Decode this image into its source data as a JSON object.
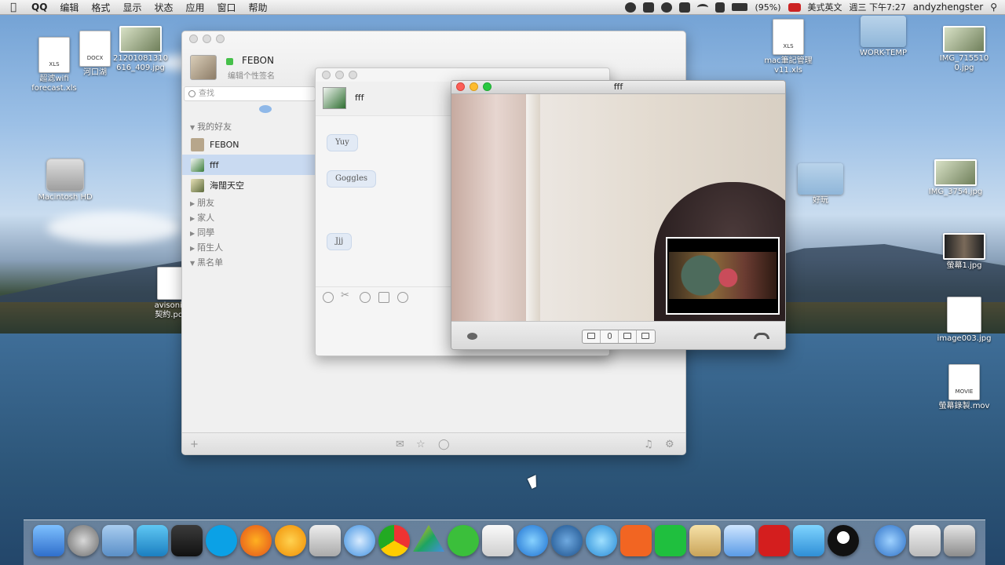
{
  "menubar": {
    "apple": "",
    "app": "QQ",
    "menus": [
      "编辑",
      "格式",
      "显示",
      "状态",
      "应用",
      "窗口",
      "帮助"
    ],
    "battery": "(95%)",
    "input_source": "美式英文",
    "clock": "週三 下午7:27",
    "user": "andyzhengster"
  },
  "desktop_icons": {
    "xls_label": "超滤wifi\nforecast.xls",
    "xls_tag": "XLS",
    "docx_label": "河口湖",
    "docx_tag": "DOCX",
    "img1_label": "21201081310\n616_409.jpg",
    "hd_label": "Macintosh HD",
    "pdf_label": "avisonic\n契約.pdf",
    "mac_xls_label": "mac筆記管理\nv11.xls",
    "mac_xls_tag": "XLS",
    "work_temp_label": "WORK-TEMP",
    "img_right1_label": "IMG_715510\n0.jpg",
    "folder2_label": "好玩",
    "img3754_label": "IMG_3754.jpg",
    "screen1_label": "螢幕1.jpg",
    "image003_label": "image003.jpg",
    "movie_label": "螢幕錄製.mov",
    "movie_tag": "MOVIE"
  },
  "qq_main": {
    "nickname": "FEBON",
    "signature": "编辑个性签名",
    "search_placeholder": "查找",
    "groups": {
      "my_friends": "我的好友",
      "friends": "朋友",
      "family": "家人",
      "classmates": "同學",
      "strangers": "陌生人",
      "blacklist": "黑名单"
    },
    "contacts": [
      "FEBON",
      "fff",
      "海闊天空"
    ],
    "selected_contact": "fff"
  },
  "chat": {
    "contact_name": "fff",
    "messages": [
      "Yuy",
      "Goggles",
      "Jjj"
    ]
  },
  "video_call": {
    "title": "fff"
  },
  "colors": {
    "selected_row": "#c9daf1",
    "online_status": "#46c04a",
    "close_red": "#fc5f57",
    "minimize_yellow": "#fdbc2e",
    "zoom_green": "#28c840"
  }
}
